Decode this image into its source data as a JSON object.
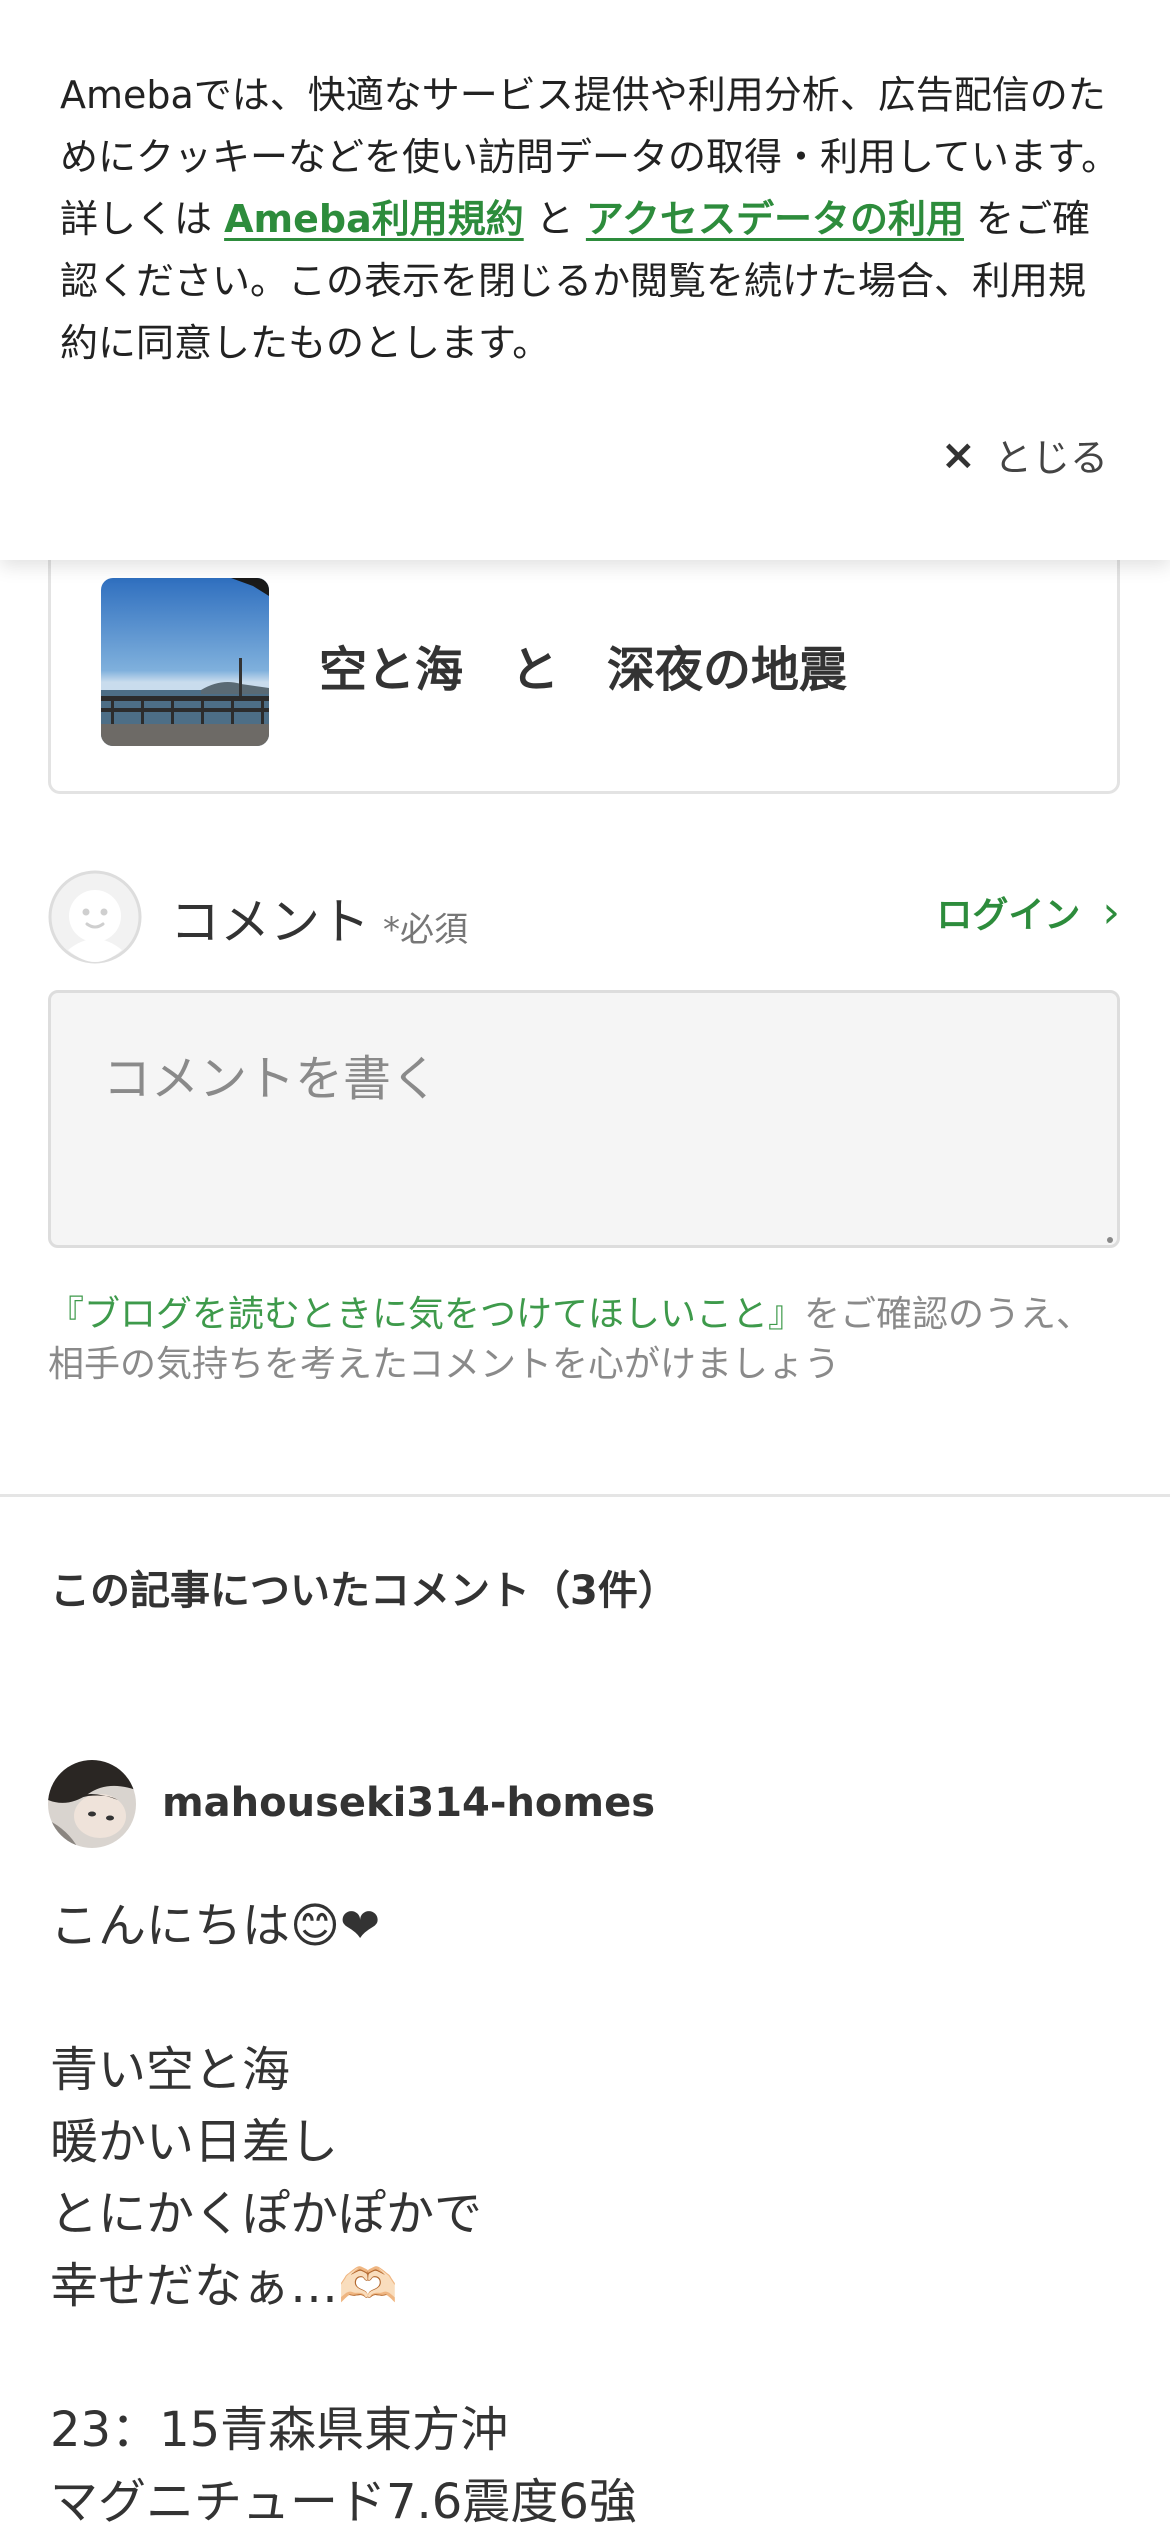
{
  "cookie_banner": {
    "text_before": "Amebaでは、快適なサービス提供や利用分析、広告配信のためにクッキーなどを使い訪問データの取得・利用しています。詳しくは ",
    "terms_link": "Ameba利用規約",
    "text_and": " と ",
    "access_link": "アクセスデータの利用",
    "text_after": " をご確認ください。この表示を閉じるか閲覧を続けた場合、利用規約に同意したものとします。",
    "close_label": "とじる",
    "close_icon": "×"
  },
  "article": {
    "title": "空と海　と　深夜の地震"
  },
  "comment_form": {
    "label": "コメント",
    "required": "*必須",
    "login_label": "ログイン",
    "login_chevron": "›",
    "placeholder": "コメントを書く",
    "guide_link": "『ブログを読むときに気をつけてほしいこと』",
    "guide_rest": "をご確認のうえ、相手の気持ちを考えたコメントを心がけましょう"
  },
  "comments": {
    "heading": "この記事についたコメント（3件）",
    "items": [
      {
        "author": "mahouseki314-homes",
        "lines": [
          "こんにちは😊❤",
          "",
          "青い空と海",
          "暖かい日差し",
          "とにかくぽかぽかで",
          "幸せだなぁ…🫶🏻",
          "",
          "23：15青森県東方沖",
          "マグニチュード7.6震度6強"
        ]
      }
    ]
  },
  "colors": {
    "accent_green": "#2d8c3c",
    "text": "#333333",
    "muted": "#8a8a8a"
  }
}
